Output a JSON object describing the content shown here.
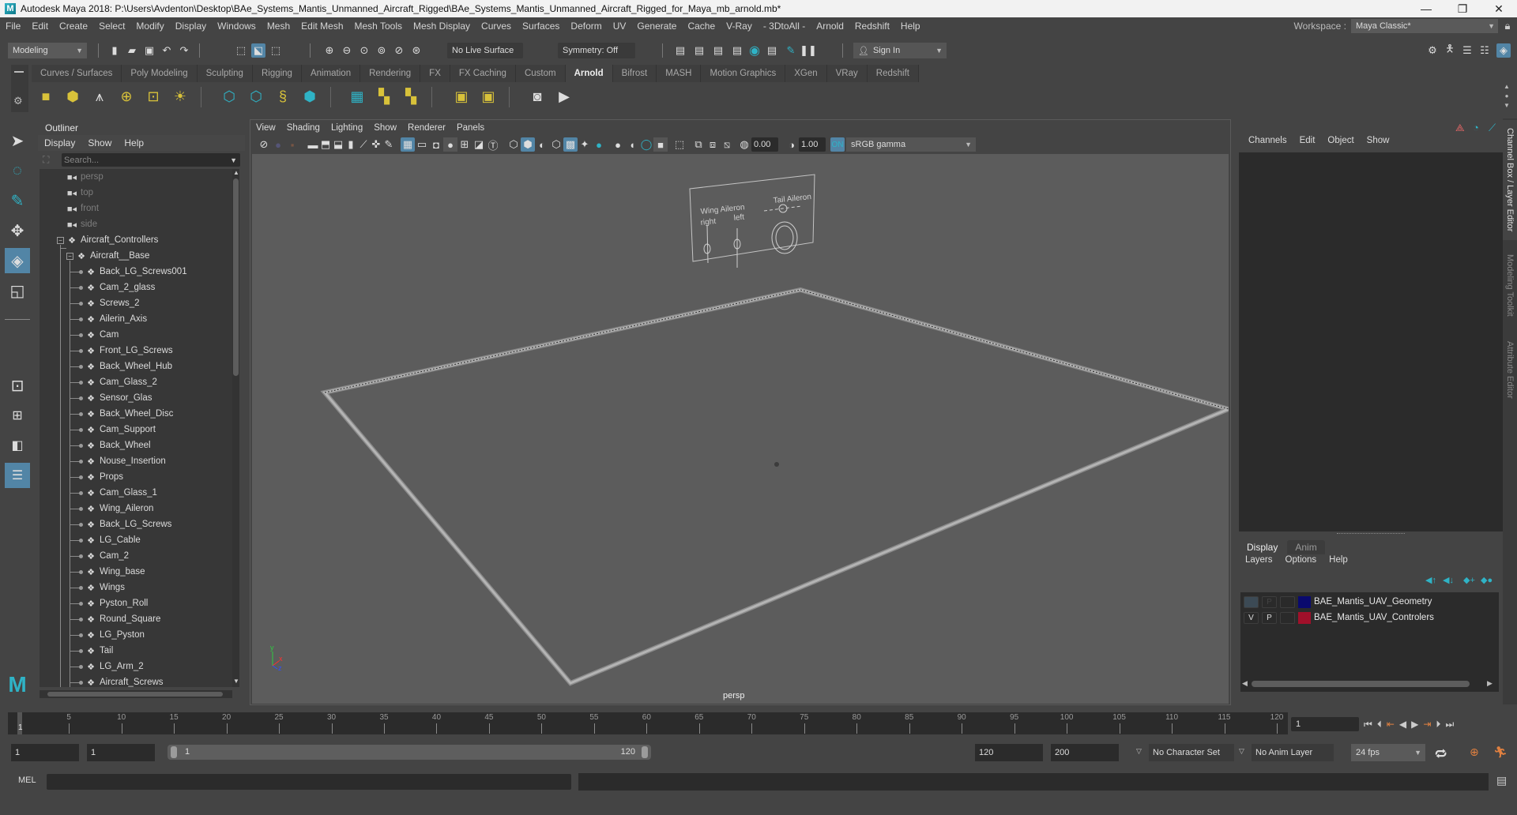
{
  "window": {
    "title": "Autodesk Maya 2018: P:\\Users\\Avdenton\\Desktop\\BAe_Systems_Mantis_Unmanned_Aircraft_Rigged\\BAe_Systems_Mantis_Unmanned_Aircraft_Rigged_for_Maya_mb_arnold.mb*",
    "logo_letter": "M",
    "minimize": "—",
    "restore": "❐",
    "close": "✕"
  },
  "menubar": {
    "items": [
      "File",
      "Edit",
      "Create",
      "Select",
      "Modify",
      "Display",
      "Windows",
      "Mesh",
      "Edit Mesh",
      "Mesh Tools",
      "Mesh Display",
      "Curves",
      "Surfaces",
      "Deform",
      "UV",
      "Generate",
      "Cache",
      "V-Ray",
      "- 3DtoAll -",
      "Arnold",
      "Redshift",
      "Help"
    ],
    "workspace_label": "Workspace :",
    "workspace_value": "Maya Classic*"
  },
  "statusline": {
    "mode": "Modeling",
    "live_surface": "No Live Surface",
    "symmetry": "Symmetry: Off",
    "sign_in": "Sign In"
  },
  "shelf": {
    "tabs": [
      "Curves / Surfaces",
      "Poly Modeling",
      "Sculpting",
      "Rigging",
      "Animation",
      "Rendering",
      "FX",
      "FX Caching",
      "Custom",
      "Arnold",
      "Bifrost",
      "MASH",
      "Motion Graphics",
      "XGen",
      "VRay",
      "Redshift"
    ],
    "active_tab": "Arnold"
  },
  "outliner": {
    "title": "Outliner",
    "menu": [
      "Display",
      "Show",
      "Help"
    ],
    "search_placeholder": "Search...",
    "cameras": [
      "persp",
      "top",
      "front",
      "side"
    ],
    "root": "Aircraft_Controllers",
    "base": "Aircraft__Base",
    "children": [
      "Back_LG_Screws001",
      "Cam_2_glass",
      "Screws_2",
      "Ailerin_Axis",
      "Cam",
      "Front_LG_Screws",
      "Back_Wheel_Hub",
      "Cam_Glass_2",
      "Sensor_Glas",
      "Back_Wheel_Disc",
      "Cam_Support",
      "Back_Wheel",
      "Nouse_Insertion",
      "Props",
      "Cam_Glass_1",
      "Wing_Aileron",
      "Back_LG_Screws",
      "LG_Cable",
      "Cam_2",
      "Wing_base",
      "Wings",
      "Pyston_Roll",
      "Round_Square",
      "LG_Pyston",
      "Tail",
      "LG_Arm_2",
      "Aircraft_Screws"
    ]
  },
  "viewport": {
    "menu": [
      "View",
      "Shading",
      "Lighting",
      "Show",
      "Renderer",
      "Panels"
    ],
    "exposure": "0.00",
    "gamma": "1.00",
    "color_space": "sRGB gamma",
    "camera_label": "persp",
    "axis": {
      "y": "y",
      "x": "x",
      "z": "z"
    },
    "card": {
      "label_left_1": "Wing Aileron",
      "label_left_2": "right",
      "label_left_3": "left",
      "label_right": "Tail Aileron"
    }
  },
  "rightpanel": {
    "menu": [
      "Channels",
      "Edit",
      "Object",
      "Show"
    ],
    "layer_tabs": [
      "Display",
      "Anim"
    ],
    "active_layer_tab": "Display",
    "layer_menu": [
      "Layers",
      "Options",
      "Help"
    ],
    "layers": [
      {
        "v": "",
        "p": "P",
        "name": "BAE_Mantis_UAV_Geometry",
        "color": "#0a0a6e"
      },
      {
        "v": "V",
        "p": "P",
        "name": "BAE_Mantis_UAV_Controlers",
        "color": "#a0102a"
      }
    ],
    "vertical_tabs": [
      "Channel Box / Layer Editor",
      "Modeling Toolkit",
      "Attribute Editor"
    ]
  },
  "timeline": {
    "ticks": [
      5,
      10,
      15,
      20,
      25,
      30,
      35,
      40,
      45,
      50,
      55,
      60,
      65,
      70,
      75,
      80,
      85,
      90,
      95,
      100,
      105,
      110,
      115,
      120
    ],
    "start": 1,
    "end": 120,
    "current_frame": "1",
    "current_frame_field": "1"
  },
  "range": {
    "start_field": "1",
    "playback_start": "1",
    "range_start_label": "1",
    "range_end_label": "120",
    "playback_end": "120",
    "end_field": "200",
    "character_set": "No Character Set",
    "anim_layer": "No Anim Layer",
    "fps": "24 fps"
  },
  "cmdline": {
    "label": "MEL"
  },
  "colors": {
    "accent": "#5285a6",
    "teal": "#2fb3c6",
    "shelf_yellow": "#d8c23a"
  }
}
